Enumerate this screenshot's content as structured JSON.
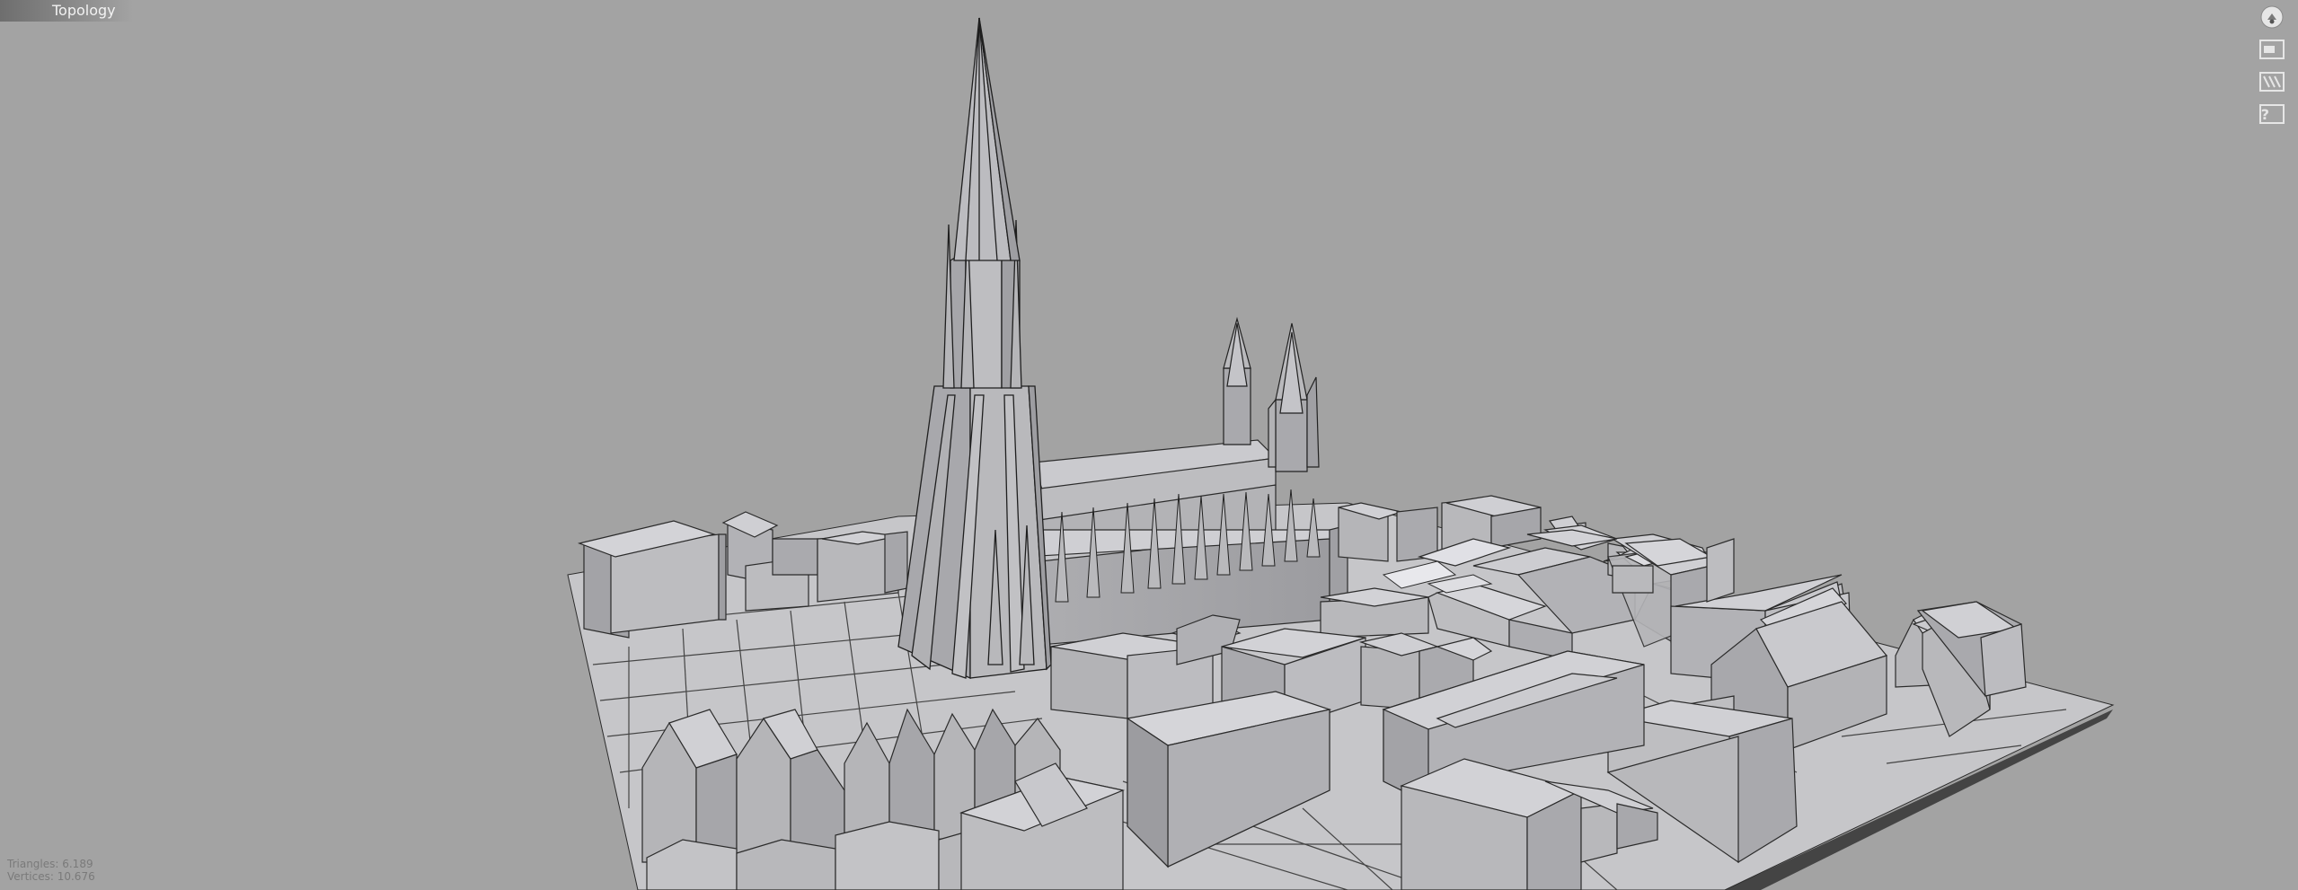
{
  "header": {
    "title": "Topology"
  },
  "toolbar": {
    "items": [
      {
        "name": "view-orientation",
        "icon": "view-orientation-icon"
      },
      {
        "name": "display-mode",
        "icon": "display-mode-icon"
      },
      {
        "name": "shading",
        "icon": "hatch-icon"
      },
      {
        "name": "help",
        "icon": "help-icon",
        "label": "?"
      }
    ]
  },
  "stats": {
    "triangles": "Triangles: 6.189",
    "vertices": "Vertices: 10.676"
  },
  "colors": {
    "background": "#a3a3a3",
    "ground": "#c2c2c5",
    "wall_light": "#c0c0c3",
    "wall_mid": "#a9a9ac",
    "roof": "#cfcfd3",
    "edge": "#2b2b2b",
    "shadow": "#3d3d3d"
  }
}
